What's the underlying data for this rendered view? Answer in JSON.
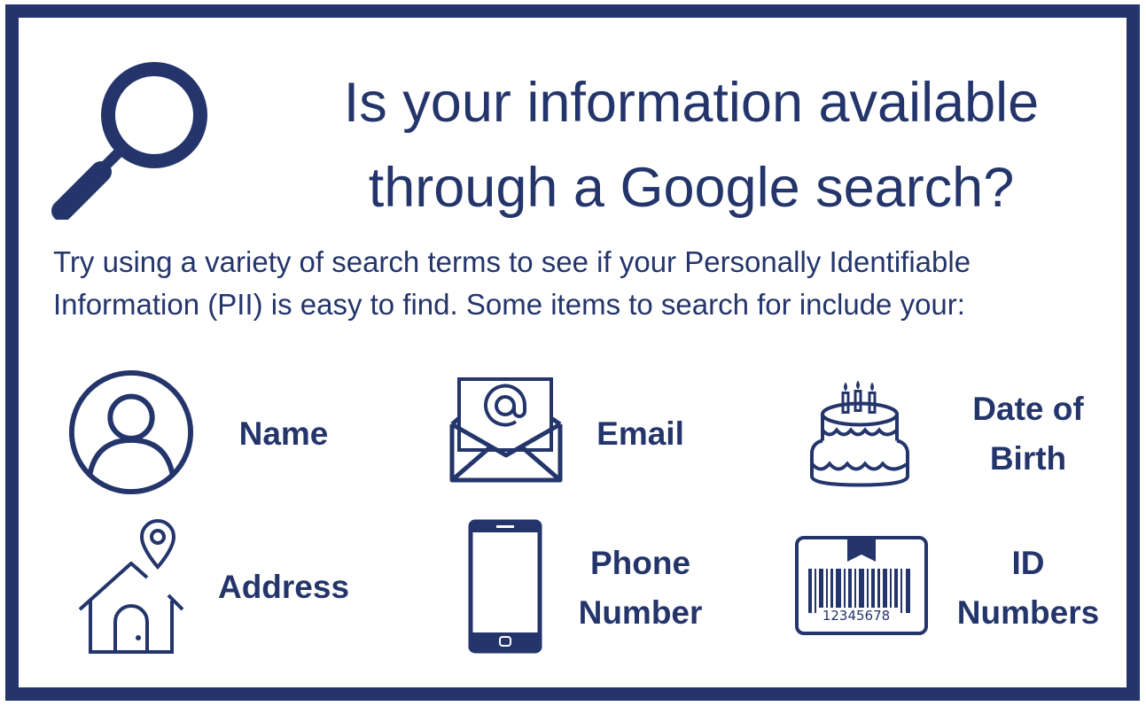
{
  "heading": {
    "line1": "Is your information available",
    "line2": "through a Google search?"
  },
  "intro": {
    "line1": "Try using a variety of search terms to see if your Personally Identifiable",
    "line2": "Information (PII) is easy to find. Some items to search for include your:"
  },
  "items": {
    "name": {
      "label": "Name",
      "icon": "user-icon"
    },
    "email": {
      "label": "Email",
      "icon": "envelope-icon"
    },
    "dob": {
      "line1": "Date of",
      "line2": "Birth",
      "icon": "birthday-cake-icon"
    },
    "address": {
      "label": "Address",
      "icon": "house-location-icon"
    },
    "phone": {
      "line1": "Phone",
      "line2": "Number",
      "icon": "smartphone-icon"
    },
    "id": {
      "line1": "ID",
      "line2": "Numbers",
      "icon": "barcode-icon"
    }
  },
  "barcode_digits": "12345678",
  "colors": {
    "navy": "#24356b",
    "background": "#ffffff"
  }
}
